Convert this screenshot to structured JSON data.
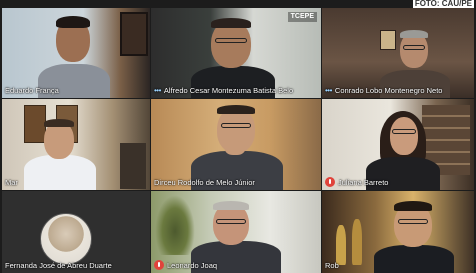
{
  "photo_credit": "FOTO: CAU/PE",
  "tiles": [
    {
      "name": "Eduardo França",
      "dots": false,
      "muted": false
    },
    {
      "name": "Alfredo Cesar Montezuma Batista Belo",
      "dots": true,
      "muted": false,
      "logo": "TCEPE"
    },
    {
      "name": "Conrado Lobo Montenegro Neto",
      "dots": true,
      "muted": false
    },
    {
      "name": "Mar",
      "dots": false,
      "muted": false
    },
    {
      "name": "Dirceu Rodolfo de Melo Júnior",
      "dots": false,
      "muted": false
    },
    {
      "name": "Juliana Barreto",
      "dots": false,
      "muted": true
    },
    {
      "name": "Fernanda José de Abreu Duarte",
      "dots": false,
      "muted": false
    },
    {
      "name": "Leonardo Joaq",
      "dots": false,
      "muted": true
    },
    {
      "name": "Rob",
      "dots": false,
      "muted": false
    }
  ]
}
